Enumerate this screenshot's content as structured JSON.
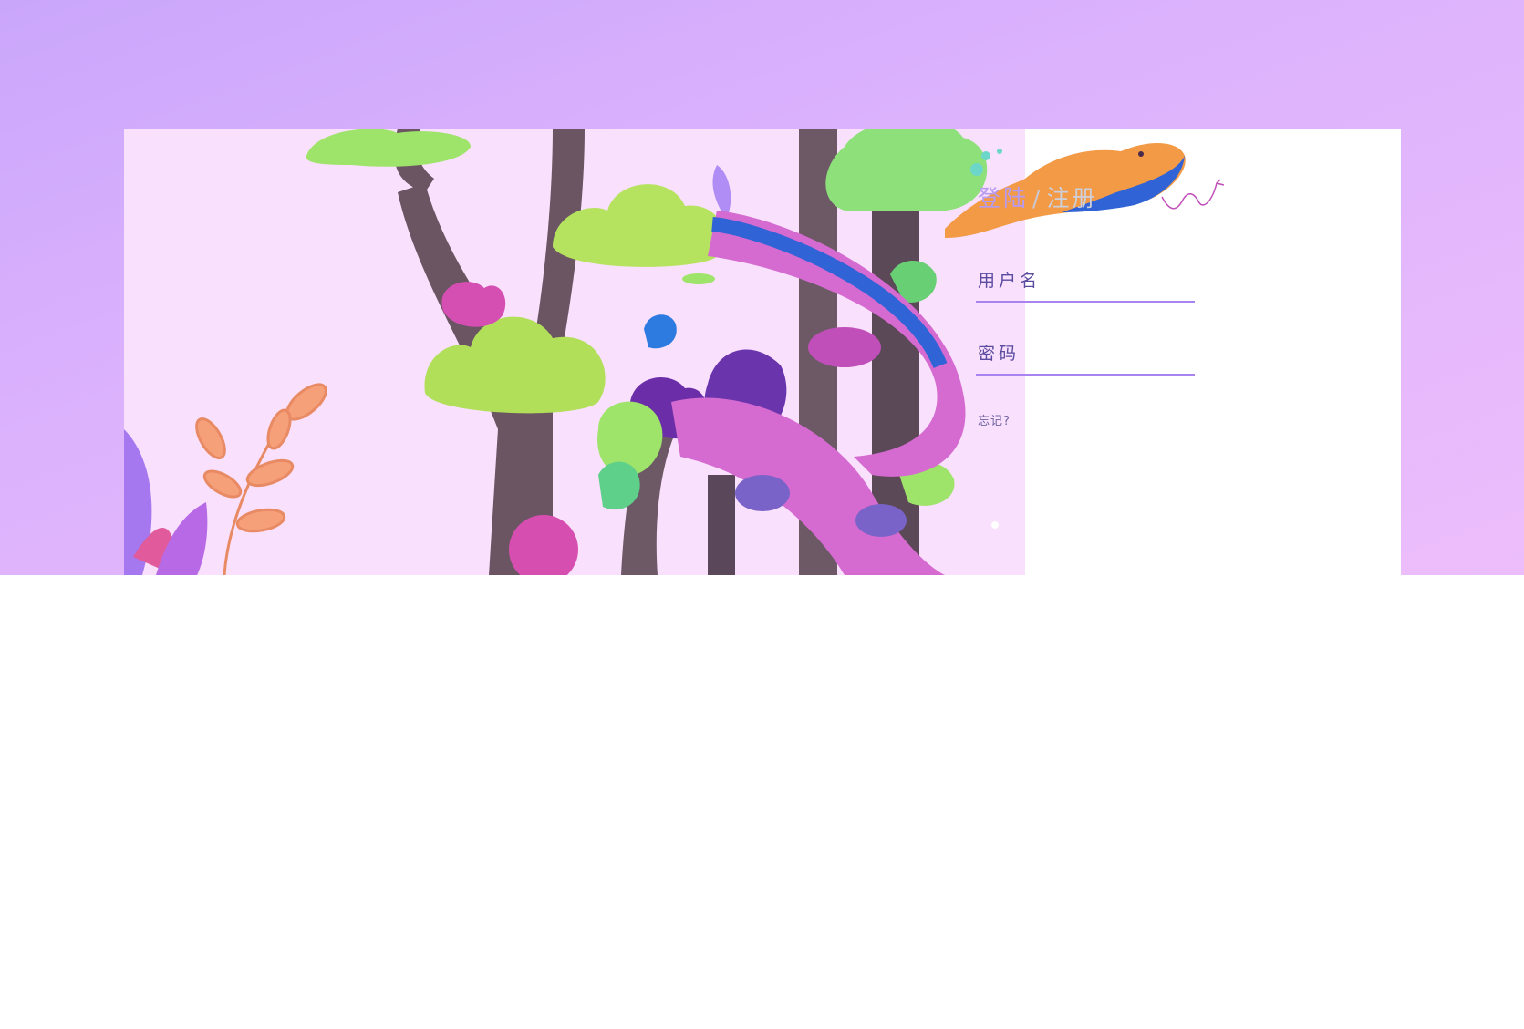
{
  "login_card": {
    "tab_login": "登陆",
    "separator": "/",
    "tab_register": "注册",
    "username_placeholder": "用户名",
    "password_placeholder": "密码",
    "forgot_link": "忘记?"
  },
  "colors": {
    "background_gradient_start": "#caa6fb",
    "background_gradient_end": "#edbdfb",
    "illustration_bg": "#f9e0fc",
    "accent": "#a983f0",
    "title_active": "#b79af2",
    "title_inactive": "#cfcfd9",
    "input_text": "#5a4aa0"
  },
  "illustration": {
    "subject": "jungle-snake-illustration"
  }
}
